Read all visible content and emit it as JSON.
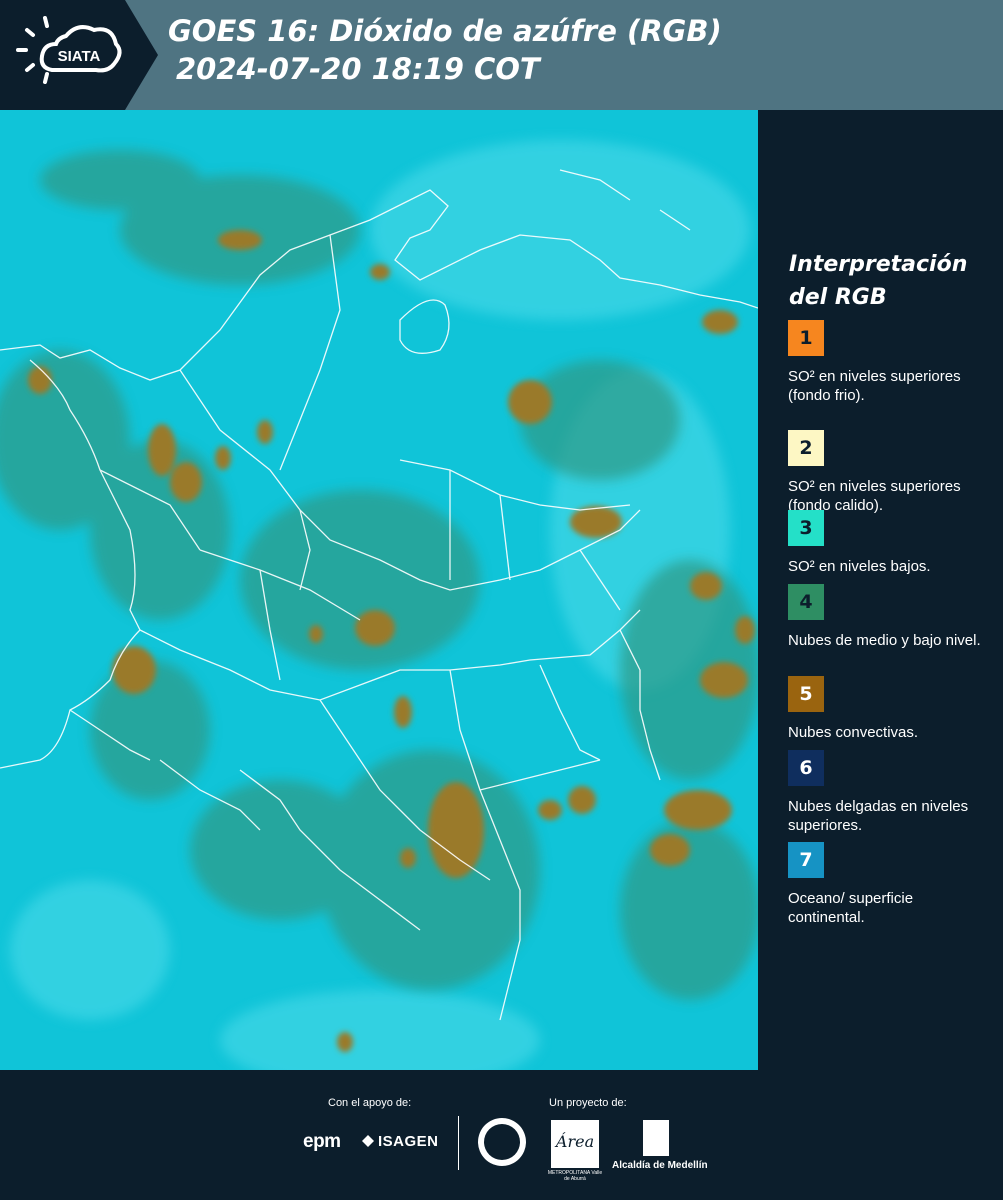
{
  "header": {
    "logo_text": "SIATA",
    "title_line1": "GOES 16: Dióxido de azúfre (RGB)",
    "title_line2": "2024-07-20 18:19 COT"
  },
  "legend": {
    "title": "Interpretación del RGB",
    "items": [
      {
        "number": "1",
        "color": "#f6861f",
        "text": "SO² en niveles superiores (fondo frio)."
      },
      {
        "number": "2",
        "color": "#fdf7c4",
        "text": "SO² en niveles superiores (fondo calido)."
      },
      {
        "number": "3",
        "color": "#24e0c8",
        "text": "SO² en niveles bajos."
      },
      {
        "number": "4",
        "color": "#2e8e63",
        "text": "Nubes de medio y bajo nivel."
      },
      {
        "number": "5",
        "color": "#9a640f",
        "text": "Nubes convectivas."
      },
      {
        "number": "6",
        "color": "#0f2e5e",
        "text": "Nubes delgadas en niveles superiores."
      },
      {
        "number": "7",
        "color": "#1693c4",
        "text": "Oceano/ superficie continental."
      }
    ]
  },
  "footer": {
    "support_label": "Con el apoyo de:",
    "project_label": "Un proyecto de:",
    "sponsor_1": "epm",
    "sponsor_2": "ISAGEN",
    "partner_area": "Área",
    "partner_area_sub": "METROPOLITANA Valle de Aburrá",
    "partner_alcaldia": "Alcaldía de Medellín"
  }
}
